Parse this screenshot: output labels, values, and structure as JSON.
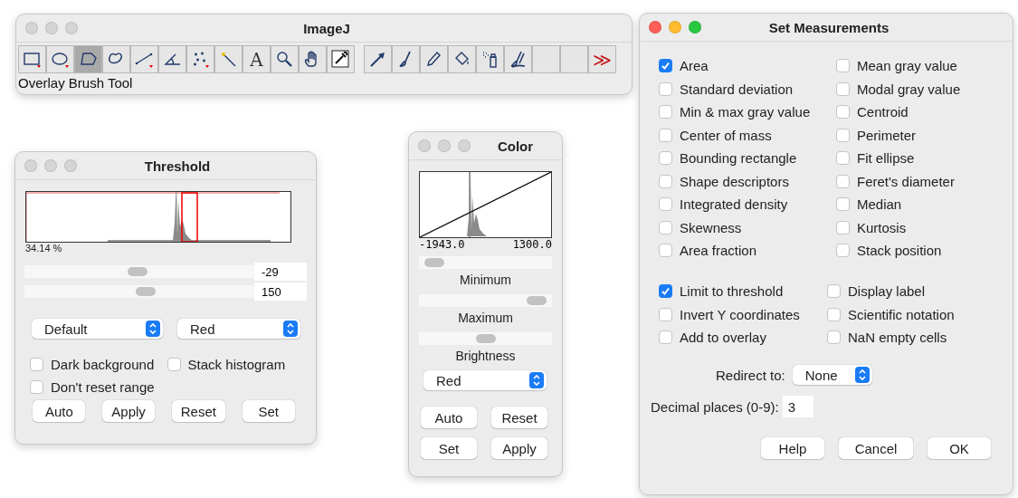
{
  "imagej": {
    "title": "ImageJ",
    "active": false,
    "tools": [
      {
        "kind": "rect",
        "selected": false
      },
      {
        "kind": "oval",
        "selected": false
      },
      {
        "kind": "polygon",
        "selected": true
      },
      {
        "kind": "freehand",
        "selected": false
      },
      {
        "kind": "line",
        "selected": false
      },
      {
        "kind": "angle",
        "selected": false
      },
      {
        "kind": "points",
        "selected": false
      },
      {
        "kind": "wand",
        "selected": false
      },
      {
        "kind": "text",
        "label": "A",
        "selected": false
      },
      {
        "kind": "magnifier",
        "selected": false
      },
      {
        "kind": "hand",
        "selected": false
      },
      {
        "kind": "dropper",
        "selected": false
      },
      {
        "kind": "gap"
      },
      {
        "kind": "arrow",
        "selected": false
      },
      {
        "kind": "brush",
        "selected": false
      },
      {
        "kind": "pencil",
        "selected": false
      },
      {
        "kind": "bucket",
        "selected": false
      },
      {
        "kind": "spray",
        "selected": false
      },
      {
        "kind": "overlaybrush",
        "selected": false
      },
      {
        "kind": "empty",
        "selected": false
      },
      {
        "kind": "empty",
        "selected": false
      },
      {
        "kind": "more",
        "label": "≫",
        "selected": false
      }
    ],
    "status": "Overlay Brush Tool"
  },
  "threshold": {
    "title": "Threshold",
    "active": false,
    "percent": "34.14 %",
    "sliders": [
      {
        "level": 0.49,
        "value": "-29"
      },
      {
        "level": 0.53,
        "value": "150"
      }
    ],
    "dropdowns": [
      "Default",
      "Red"
    ],
    "checkboxes": [
      {
        "label": "Dark background",
        "checked": false
      },
      {
        "label": "Stack histogram",
        "checked": false
      },
      {
        "label": "Don't reset range",
        "checked": false
      }
    ],
    "buttons": [
      "Auto",
      "Apply",
      "Reset",
      "Set"
    ]
  },
  "color": {
    "title": "Color",
    "active": false,
    "min_label": "-1943.0",
    "max_label": "1300.0",
    "sliders": [
      {
        "label": "Minimum",
        "level": 0.05
      },
      {
        "label": "Maximum",
        "level": 0.95
      },
      {
        "label": "Brightness",
        "level": 0.5
      }
    ],
    "dropdown": "Red",
    "buttons": [
      "Auto",
      "Reset",
      "Set",
      "Apply"
    ]
  },
  "measurements": {
    "title": "Set Measurements",
    "active": true,
    "left": [
      {
        "label": "Area",
        "checked": true
      },
      {
        "label": "Standard deviation",
        "checked": false
      },
      {
        "label": "Min & max gray value",
        "checked": false
      },
      {
        "label": "Center of mass",
        "checked": false
      },
      {
        "label": "Bounding rectangle",
        "checked": false
      },
      {
        "label": "Shape descriptors",
        "checked": false
      },
      {
        "label": "Integrated density",
        "checked": false
      },
      {
        "label": "Skewness",
        "checked": false
      },
      {
        "label": "Area fraction",
        "checked": false
      }
    ],
    "right": [
      {
        "label": "Mean gray value",
        "checked": false
      },
      {
        "label": "Modal gray value",
        "checked": false
      },
      {
        "label": "Centroid",
        "checked": false
      },
      {
        "label": "Perimeter",
        "checked": false
      },
      {
        "label": "Fit ellipse",
        "checked": false
      },
      {
        "label": "Feret's diameter",
        "checked": false
      },
      {
        "label": "Median",
        "checked": false
      },
      {
        "label": "Kurtosis",
        "checked": false
      },
      {
        "label": "Stack position",
        "checked": false
      }
    ],
    "left2": [
      {
        "label": "Limit to threshold",
        "checked": true
      },
      {
        "label": "Invert Y coordinates",
        "checked": false
      },
      {
        "label": "Add to overlay",
        "checked": false
      }
    ],
    "right2": [
      {
        "label": "Display label",
        "checked": false
      },
      {
        "label": "Scientific notation",
        "checked": false
      },
      {
        "label": "NaN empty cells",
        "checked": false
      }
    ],
    "redirect_label": "Redirect to:",
    "redirect": "None",
    "decimal_label": "Decimal places (0-9):",
    "decimal": "3",
    "buttons": [
      "Help",
      "Cancel",
      "OK"
    ]
  }
}
